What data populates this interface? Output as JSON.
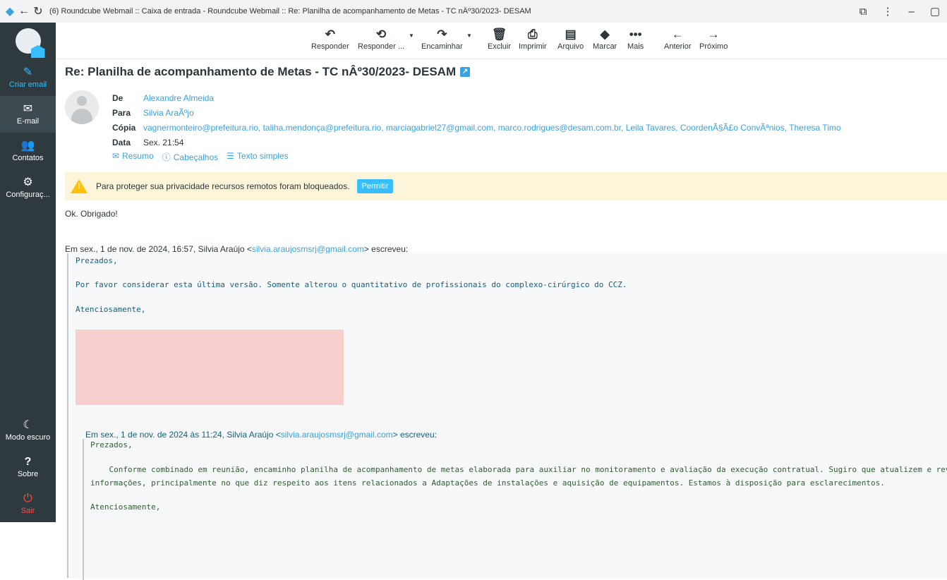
{
  "browser": {
    "tab_title": "(6) Roundcube Webmail :: Caixa de entrada - Roundcube Webmail :: Re: Planilha de acompanhamento de Metas - TC nÂº30/2023- DESAM"
  },
  "sidebar": {
    "items": [
      {
        "label": "Criar email",
        "icon": "compose-icon"
      },
      {
        "label": "E-mail",
        "icon": "envelope-icon"
      },
      {
        "label": "Contatos",
        "icon": "contacts-icon"
      },
      {
        "label": "Configuraç...",
        "icon": "gear-icon"
      }
    ],
    "bottom": [
      {
        "label": "Modo escuro",
        "icon": "moon-icon"
      },
      {
        "label": "Sobre",
        "icon": "question-icon"
      },
      {
        "label": "Sair",
        "icon": "power-icon"
      }
    ]
  },
  "toolbar": {
    "reply": "Responder",
    "reply_all": "Responder ...",
    "forward": "Encaminhar",
    "delete": "Excluir",
    "print": "Imprimir",
    "archive": "Arquivo",
    "mark": "Marcar",
    "more": "Mais",
    "previous": "Anterior",
    "next": "Próximo"
  },
  "message": {
    "subject": "Re: Planilha de acompanhamento de Metas - TC nÂº30/2023- DESAM",
    "headers": {
      "from_label": "De",
      "from": "Alexandre Almeida",
      "to_label": "Para",
      "to": "Silvia AraÃºjo",
      "cc_label": "Cópia",
      "cc": "vagnermonteiro@prefeitura.rio, taliha.mendonça@prefeitura.rio, marciagabriel27@gmail.com, marco.rodrigues@desam.com.br, Leila Tavares, CoordenÃ§Ã£o ConvÃªnios, Theresa Timo",
      "date_label": "Data",
      "date": "Sex. 21:54"
    },
    "header_links": {
      "summary": "Resumo",
      "headers": "Cabeçalhos",
      "plain_text": "Texto simples"
    },
    "notice": {
      "text": "Para proteger sua privacidade recursos remotos foram bloqueados.",
      "button": "Permitir"
    },
    "body": "Ok. Obrigado!",
    "quote1": {
      "intro_prefix": "Em sex., 1 de nov. de 2024, 16:57, Silvia Araújo <",
      "intro_email": "silvia.araujosmsrj@gmail.com",
      "intro_suffix": "> escreveu:",
      "line1": "Prezados,",
      "line2": "Por favor considerar esta última versão. Somente alterou o quantitativo de profissionais do complexo-cirúrgico do CCZ.",
      "line3": "Atenciosamente,"
    },
    "quote2": {
      "intro_prefix": "Em sex., 1 de nov. de 2024 às 11:24, Silvia Araújo <",
      "intro_email": "silvia.araujosmsrj@gmail.com",
      "intro_suffix": "> escreveu:",
      "line1": "Prezados,",
      "line2": "    Conforme combinado em reunião, encaminho planilha de acompanhamento de metas elaborada para auxiliar no monitoramento e avaliação da execução contratual. Sugiro que atualizem e revisem as",
      "line3": "informações, principalmente no que diz respeito aos itens relacionados a Adaptações de instalações e aquisição de equipamentos. Estamos à disposição para esclarecimentos.",
      "line4": "Atenciosamente,"
    }
  }
}
